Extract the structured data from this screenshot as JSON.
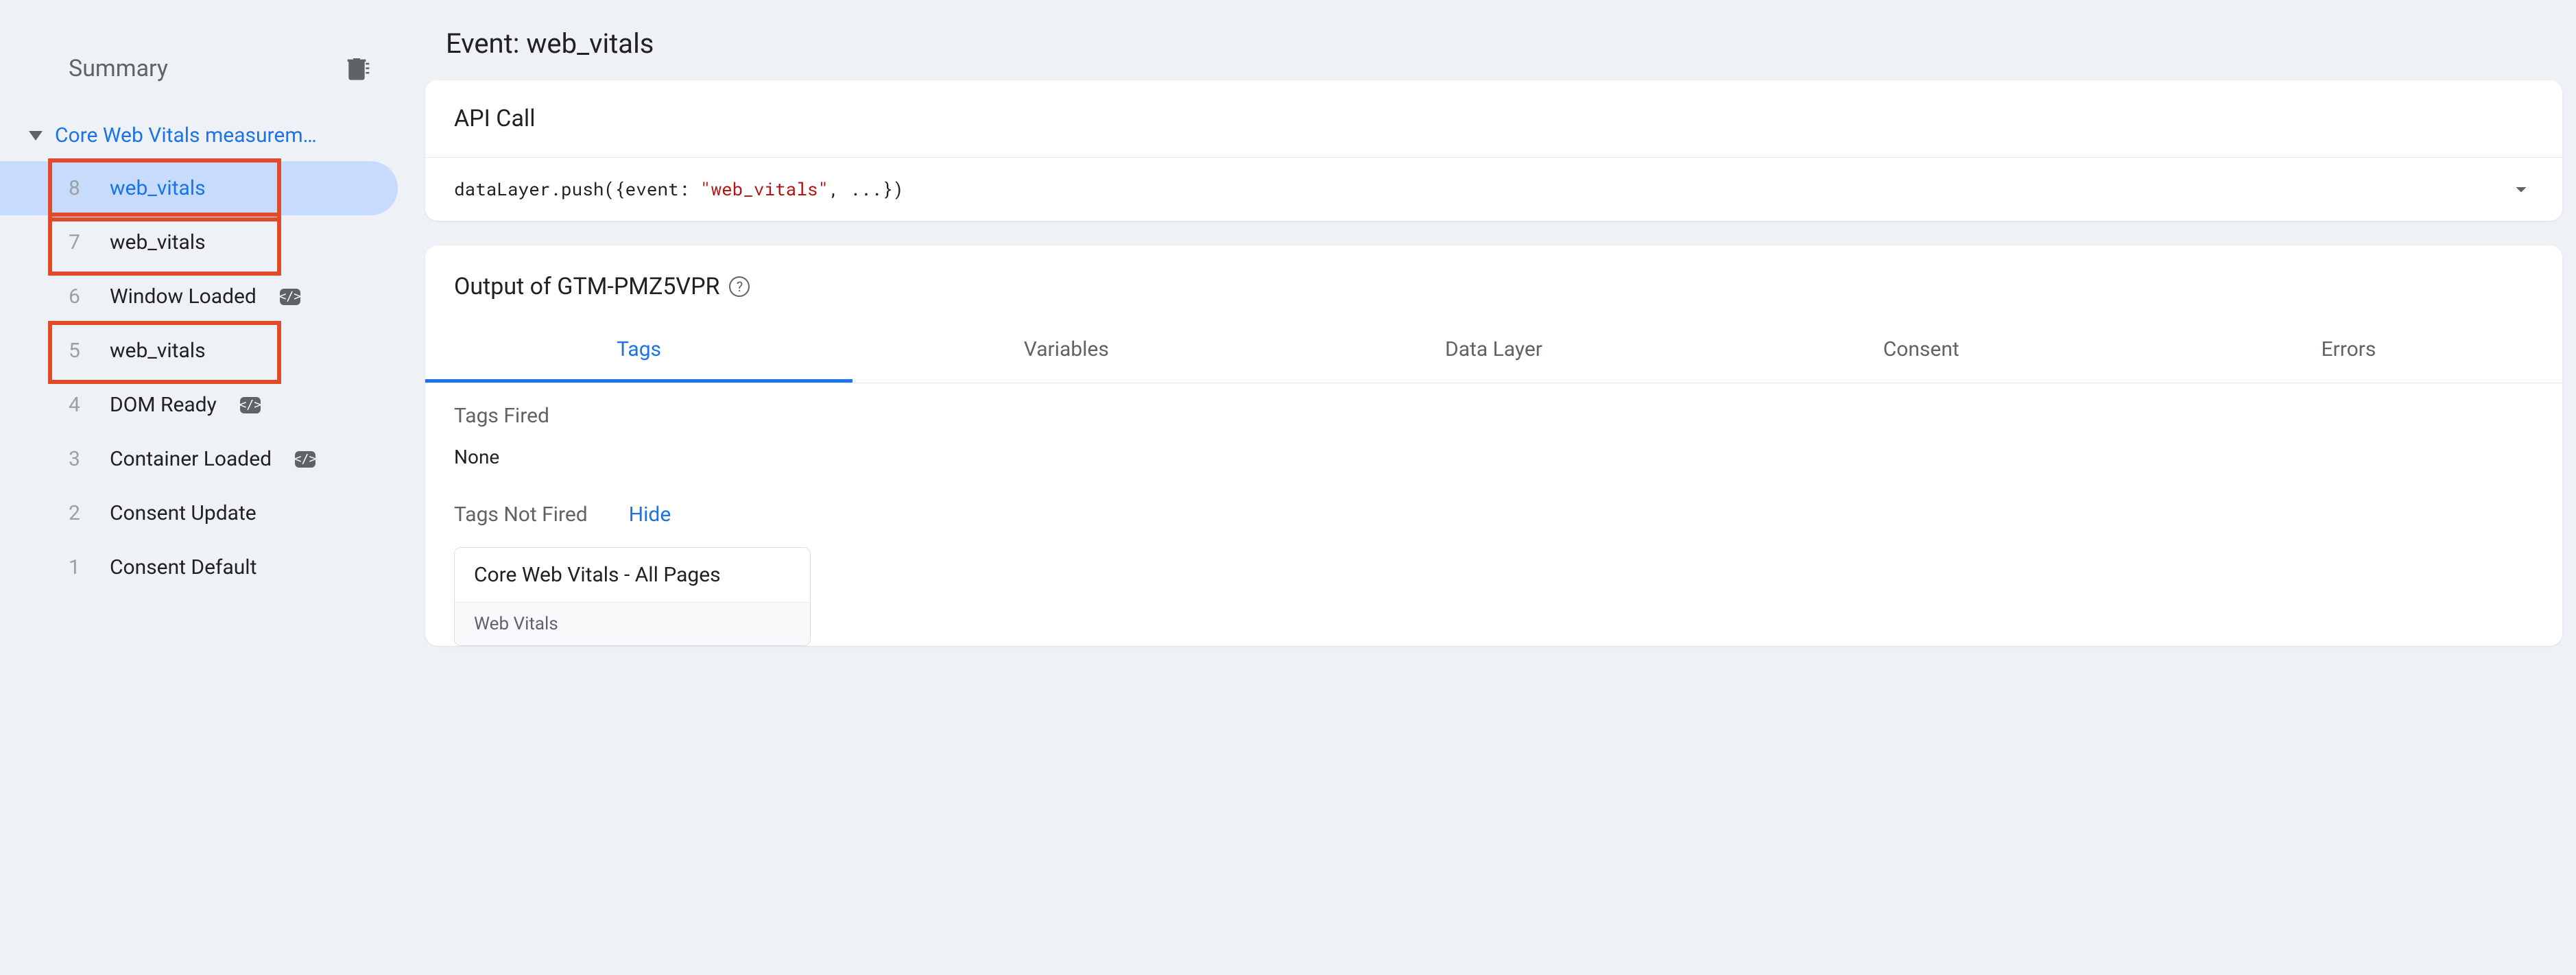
{
  "sidebar": {
    "summary_label": "Summary",
    "clear_icon": "clear-all-icon",
    "group": {
      "label": "Core Web Vitals measurem…",
      "events": [
        {
          "num": "8",
          "label": "web_vitals",
          "selected": true,
          "badge": false,
          "highlighted": true
        },
        {
          "num": "7",
          "label": "web_vitals",
          "selected": false,
          "badge": false,
          "highlighted": true
        },
        {
          "num": "6",
          "label": "Window Loaded",
          "selected": false,
          "badge": true,
          "highlighted": false
        },
        {
          "num": "5",
          "label": "web_vitals",
          "selected": false,
          "badge": false,
          "highlighted": true
        },
        {
          "num": "4",
          "label": "DOM Ready",
          "selected": false,
          "badge": true,
          "highlighted": false
        },
        {
          "num": "3",
          "label": "Container Loaded",
          "selected": false,
          "badge": true,
          "highlighted": false
        },
        {
          "num": "2",
          "label": "Consent Update",
          "selected": false,
          "badge": false,
          "highlighted": false
        },
        {
          "num": "1",
          "label": "Consent Default",
          "selected": false,
          "badge": false,
          "highlighted": false
        }
      ]
    }
  },
  "main": {
    "title": "Event: web_vitals",
    "api_call": {
      "title": "API Call",
      "prefix": "dataLayer.push({event: ",
      "event_string": "\"web_vitals\"",
      "suffix": ", ...})"
    },
    "output": {
      "title": "Output of GTM-PMZ5VPR",
      "tabs": [
        {
          "label": "Tags",
          "active": true
        },
        {
          "label": "Variables",
          "active": false
        },
        {
          "label": "Data Layer",
          "active": false
        },
        {
          "label": "Consent",
          "active": false
        },
        {
          "label": "Errors",
          "active": false
        }
      ],
      "fired_label": "Tags Fired",
      "fired_none": "None",
      "not_fired_label": "Tags Not Fired",
      "hide_label": "Hide",
      "not_fired_tag": {
        "name": "Core Web Vitals - All Pages",
        "type": "Web Vitals"
      }
    }
  }
}
